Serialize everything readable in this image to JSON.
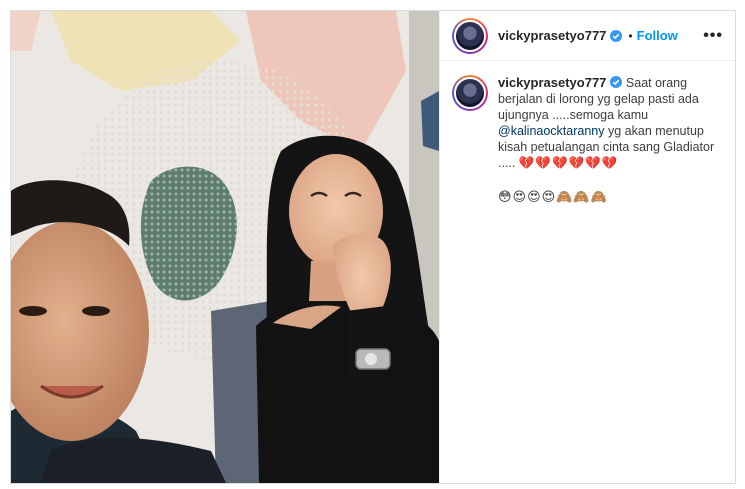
{
  "post": {
    "username": "vickyprasetyo777",
    "follow_label": "Follow",
    "separator": "•",
    "more_label": "•••",
    "caption": {
      "username": "vickyprasetyo777",
      "text_before_mention": "Saat orang berjalan di lorong yg gelap pasti ada ujungnya .....semoga kamu",
      "mention": "@kalinaocktaranny",
      "text_after_mention": "yg akan menutup kisah petualangan cinta sang Gladiator .....",
      "hearts": "💔💔💔💔💔💔",
      "emojis": "😳😍😍😍🙈🙈🙈"
    }
  },
  "colors": {
    "accent": "#0095f6",
    "verified": "#3897f0",
    "mention": "#00376b"
  },
  "icons": [
    "verified-badge-icon",
    "more-options-icon"
  ]
}
